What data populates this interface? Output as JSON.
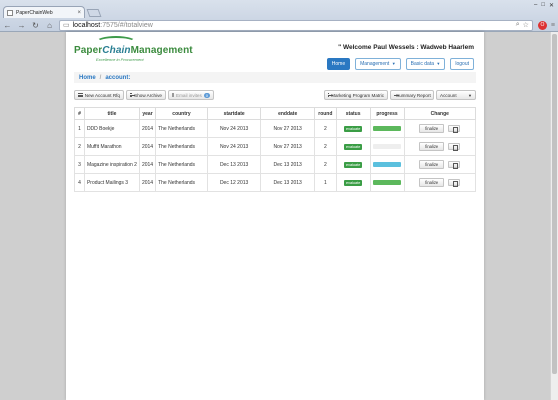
{
  "browser": {
    "tab_title": "PaperChainWeb",
    "url_host": "localhost",
    "url_path": ":7575/#/totalview",
    "close_glyph": "×"
  },
  "header": {
    "logo_part1": "Paper",
    "logo_part2": "Chain",
    "logo_part3": "Management",
    "tagline": "Excellence in Procurement",
    "welcome": "Welcome Paul Wessels : Wadweb Haarlem",
    "nav": [
      {
        "label": "Home",
        "active": true
      },
      {
        "label": "Management",
        "dropdown": true
      },
      {
        "label": "Basic data",
        "dropdown": true
      },
      {
        "label": "logout"
      }
    ]
  },
  "breadcrumb": {
    "home": "Home",
    "current": "account:"
  },
  "actions": {
    "new_account": "New Account Rfq",
    "show_archive": "Show Archive",
    "email_invites": "Email invites",
    "email_count": "0",
    "marketing_matrix": "Marketing Program Matric",
    "summary_report": "Summary Report",
    "account": "Account"
  },
  "table": {
    "columns": [
      "#",
      "title",
      "year",
      "country",
      "startdate",
      "enddate",
      "round",
      "status",
      "progress",
      "Change"
    ],
    "finalize_label": "finalize",
    "rows": [
      {
        "num": "1",
        "title": "DDD Boekje",
        "year": "2014",
        "country": "The Netherlands",
        "startdate": "Nov 24 2013",
        "enddate": "Nov 27 2013",
        "round": "2",
        "status": "evaluate",
        "progress": 1.0,
        "progress_color": "#5cb85c"
      },
      {
        "num": "2",
        "title": "Muffit Marathon",
        "year": "2014",
        "country": "The Netherlands",
        "startdate": "Nov 24 2013",
        "enddate": "Nov 27 2013",
        "round": "2",
        "status": "evaluate",
        "progress": 0.0,
        "progress_color": "#5cb85c"
      },
      {
        "num": "3",
        "title": "Magazine inspiration 2",
        "year": "2014",
        "country": "The Netherlands",
        "startdate": "Dec 13 2013",
        "enddate": "Dec 13 2013",
        "round": "2",
        "status": "evaluate",
        "progress": 1.0,
        "progress_color": "#5bc0de"
      },
      {
        "num": "4",
        "title": "Product Mailings 3",
        "year": "2014",
        "country": "The Netherlands",
        "startdate": "Dec 12 2013",
        "enddate": "Dec 13 2013",
        "round": "1",
        "status": "evaluate",
        "progress": 1.0,
        "progress_color": "#5cb85c"
      }
    ]
  }
}
